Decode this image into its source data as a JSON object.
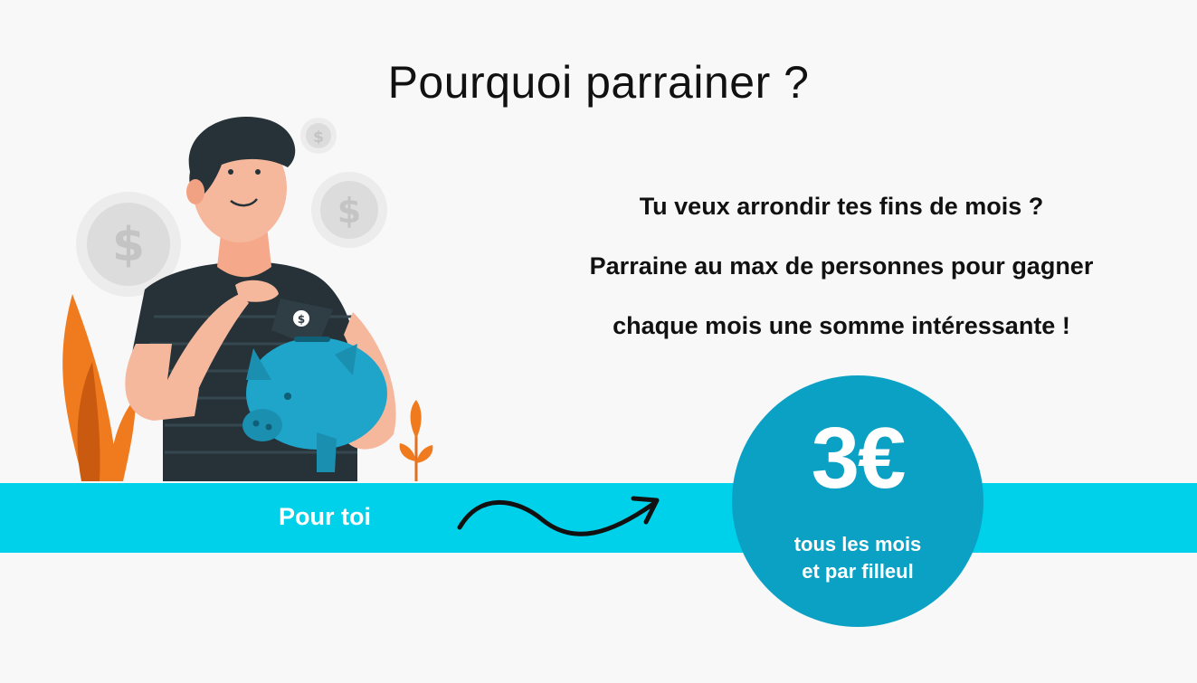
{
  "header": {
    "title": "Pourquoi parrainer ?"
  },
  "pitch": {
    "lines": [
      "Tu veux arrondir tes fins de mois ?",
      "Parraine au max de personnes pour gagner",
      "chaque mois une somme intéressante  !"
    ]
  },
  "band": {
    "label": "Pour toi"
  },
  "badge": {
    "amount": "3€",
    "line1": "tous les mois",
    "line2": "et par filleul"
  },
  "colors": {
    "band": "#00d1ea",
    "badge": "#0aa1c4",
    "piggy": "#1ea5c9",
    "leaf": "#f07a1e",
    "shirt": "#263238"
  },
  "illustration": {
    "icons": [
      "man-icon",
      "piggy-bank-icon",
      "banknote-icon",
      "coin-icon",
      "leaf-icon",
      "arrow-icon"
    ]
  }
}
